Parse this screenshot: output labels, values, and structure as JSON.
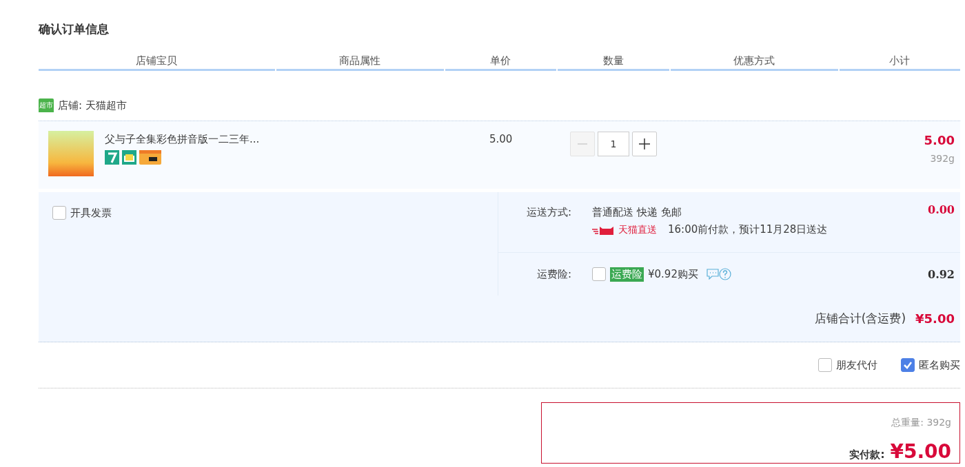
{
  "page_title": "确认订单信息",
  "columns": [
    "店铺宝贝",
    "商品属性",
    "单价",
    "数量",
    "优惠方式",
    "小计"
  ],
  "shop": {
    "badge": "超市",
    "label": "店铺: 天猫超市"
  },
  "item": {
    "title": "父与子全集彩色拼音版一二三年...",
    "unit_price": "5.00",
    "quantity": "1",
    "decrease_disabled": true,
    "subtotal": "5.00",
    "weight": "392g"
  },
  "invoice": {
    "label": "开具发票",
    "checked": false
  },
  "shipping": {
    "label": "运送方式:",
    "method": "普通配送 快递 免邮",
    "brand": "天猫直送",
    "eta": "16:00前付款，预计11月28日送达",
    "fee": "0.00"
  },
  "insurance": {
    "label": "运费险:",
    "checked": false,
    "tag": "运费险",
    "offer": "¥0.92购买",
    "fee": "0.92"
  },
  "store_total": {
    "label": "店铺合计(含运费)",
    "amount": "¥5.00"
  },
  "options": [
    {
      "label": "朋友代付",
      "checked": false
    },
    {
      "label": "匿名购买",
      "checked": true
    }
  ],
  "payment": {
    "weight_label": "总重量:",
    "weight": "392g",
    "label": "实付款:",
    "amount": "¥5.00"
  }
}
